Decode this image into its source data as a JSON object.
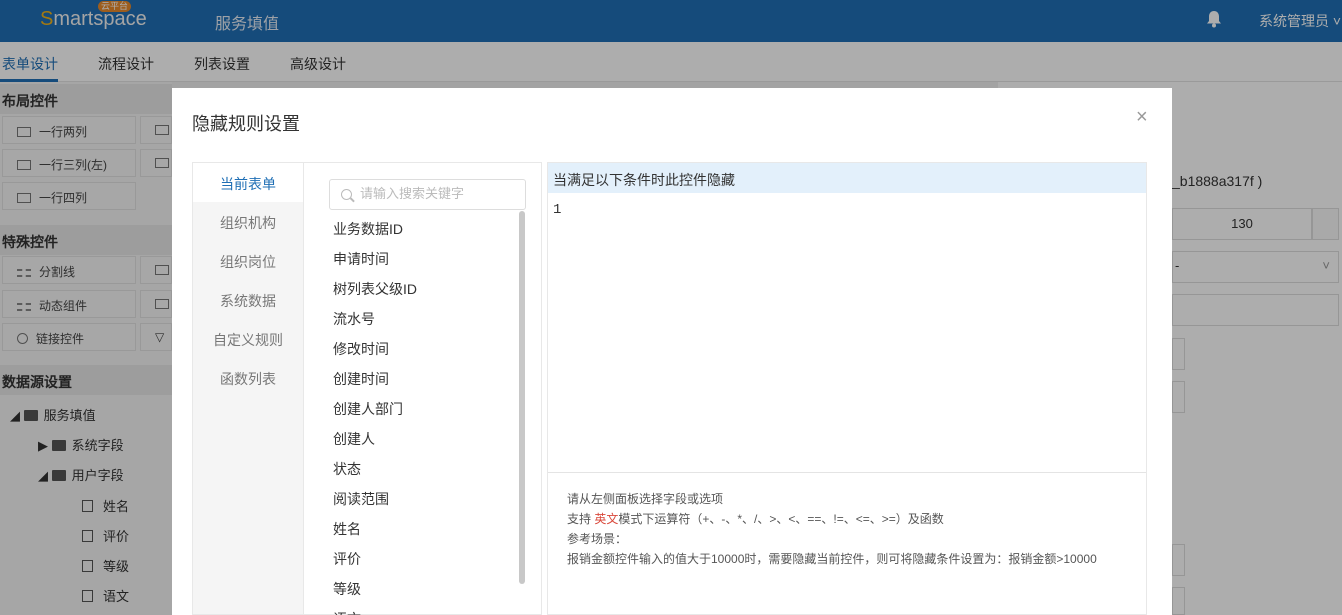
{
  "header": {
    "logo_text": "Smartspace",
    "logo_badge": "云平台",
    "app_title": "服务填值",
    "user": "系统管理员"
  },
  "tabs": [
    "表单设计",
    "流程设计",
    "列表设置",
    "高级设计"
  ],
  "left_panel": {
    "layout_title": "布局控件",
    "layout_items": [
      "一行两列",
      "一行三列(左)",
      "一行四列"
    ],
    "special_title": "特殊控件",
    "special_items": [
      "分割线",
      "动态组件",
      "链接控件"
    ],
    "datasource_title": "数据源设置",
    "tree": {
      "root": "服务填值",
      "system_fields": "系统字段",
      "user_fields": "用户字段",
      "user_children": [
        "姓名",
        "评价",
        "等级",
        "语文"
      ]
    }
  },
  "background_right": {
    "id_text": "_b1888a317f )",
    "number_value": "130",
    "select_value": "-"
  },
  "modal": {
    "title": "隐藏规则设置",
    "close": "×",
    "side_tabs": [
      "当前表单",
      "组织机构",
      "组织岗位",
      "系统数据",
      "自定义规则",
      "函数列表"
    ],
    "search_placeholder": "请输入搜索关键字",
    "fields": [
      "业务数据ID",
      "申请时间",
      "树列表父级ID",
      "流水号",
      "修改时间",
      "创建时间",
      "创建人部门",
      "创建人",
      "状态",
      "阅读范围",
      "姓名",
      "评价",
      "等级",
      "语文"
    ],
    "rule_header": "当满足以下条件时此控件隐藏",
    "editor_content": "1",
    "help": {
      "line1": "请从左侧面板选择字段或选项",
      "line2_prefix": "支持 ",
      "line2_highlight": "英文",
      "line2_suffix": "模式下运算符（+、-、*、/、>、<、==、!=、<=、>=）及函数",
      "line3": "参考场景：",
      "line4": "报销金额控件输入的值大于10000时，需要隐藏当前控件，则可将隐藏条件设置为：报销金额>10000"
    }
  }
}
